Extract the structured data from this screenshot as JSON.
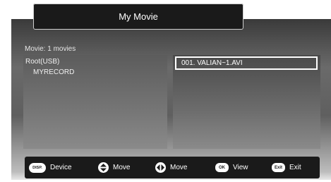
{
  "header": {
    "title": "My Movie"
  },
  "browser": {
    "count_label": "Movie: 1 movies",
    "tree": [
      {
        "label": "Root(USB)"
      },
      {
        "label": "MYRECORD"
      }
    ],
    "files": [
      {
        "label": "001. VALIAN~1.AVI",
        "selected": true
      }
    ]
  },
  "bottom_bar": {
    "buttons": [
      {
        "icon": "disp-key-icon",
        "key": "DISP.",
        "label": "Device"
      },
      {
        "icon": "up-down-arrow-icon",
        "label": "Move"
      },
      {
        "icon": "left-right-arrow-icon",
        "label": "Move"
      },
      {
        "icon": "ok-key-icon",
        "key": "OK",
        "label": "View"
      },
      {
        "icon": "exit-key-icon",
        "key": "Exit",
        "label": "Exit"
      }
    ]
  },
  "colors": {
    "bar_background": "#1a1a1a",
    "selection_border": "#ffffff"
  }
}
